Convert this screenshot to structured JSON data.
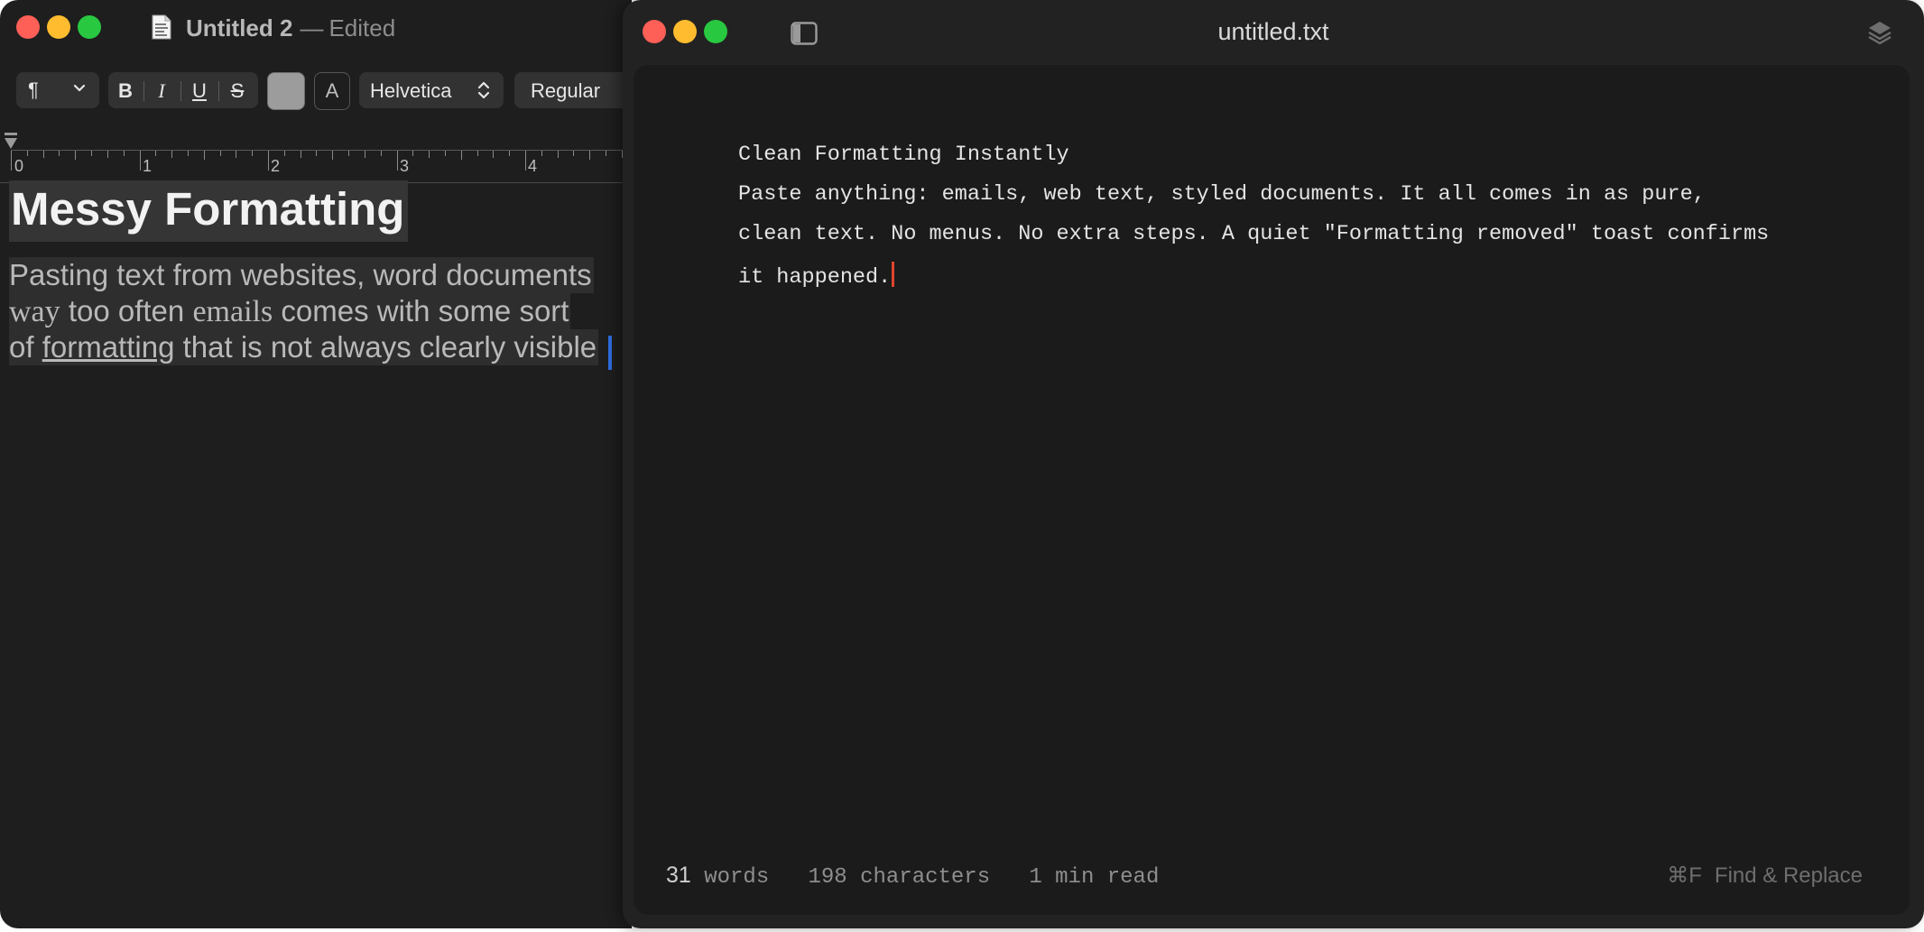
{
  "textedit": {
    "title": "Untitled 2",
    "title_separator": "—",
    "edited_label": "Edited",
    "toolbar": {
      "paragraph_symbol": "¶",
      "bold": "B",
      "italic": "I",
      "underline": "U",
      "strikethrough": "S",
      "bg_color_label": "A",
      "font_family": "Helvetica",
      "font_style": "Regular"
    },
    "ruler_numbers": [
      "0",
      "1",
      "2",
      "3",
      "4"
    ],
    "document": {
      "heading": "Messy Formatting",
      "line1": "Pasting text from websites, word documents",
      "line2_a": "way",
      "line2_b": " too often ",
      "line2_c": "emails",
      "line2_d": " comes with some sort",
      "line3_a": "of ",
      "line3_b": "formatting",
      "line3_c": " that is not always clearly visible"
    }
  },
  "plaintext": {
    "title": "untitled.txt",
    "content": {
      "line1": "Clean Formatting Instantly",
      "line2": "Paste anything: emails, web text, styled documents. It all comes in as pure,",
      "line3": "clean text. No menus. No extra steps. A quiet \"Formatting removed\" toast confirms",
      "line4": "it happened."
    },
    "status": {
      "word_count": "31",
      "word_label": "words",
      "char_count": "198",
      "char_label": "characters",
      "read_time": "1",
      "read_label": "min read"
    },
    "find_replace": {
      "shortcut": "⌘F",
      "label": "Find & Replace"
    }
  },
  "colors": {
    "close": "#fe5f57",
    "minimize": "#febc2e",
    "zoom": "#28c840",
    "caret_left": "#2f6ce0",
    "caret_right": "#e0452e"
  }
}
